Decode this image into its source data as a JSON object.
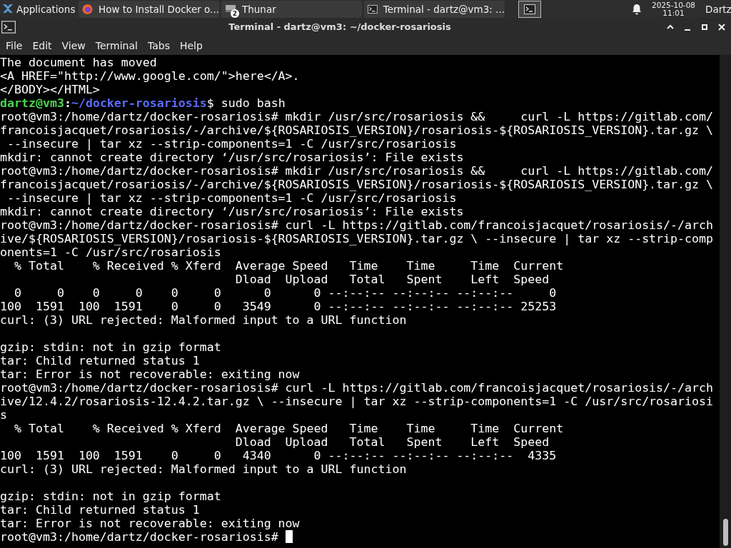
{
  "taskbar": {
    "menu_label": "Applications",
    "tasks": [
      {
        "kind": "browser",
        "label": "How to Install Docker o...",
        "selected": false
      },
      {
        "kind": "files",
        "label": "Thunar",
        "badge": "2",
        "selected": false
      },
      {
        "kind": "terminal",
        "label": "Terminal - dartz@vm3: ...",
        "selected": false
      }
    ],
    "date": "2025-10-08",
    "time": "11:01",
    "user": "Dartz"
  },
  "window": {
    "title": "Terminal - dartz@vm3: ~/docker-rosariosis"
  },
  "menu": [
    "File",
    "Edit",
    "View",
    "Terminal",
    "Tabs",
    "Help"
  ],
  "terminal": {
    "lines": [
      {
        "kind": "text",
        "text": "The document has moved"
      },
      {
        "kind": "text",
        "text": "<A HREF=\"http://www.google.com/\">here</A>."
      },
      {
        "kind": "text",
        "text": "</BODY></HTML>"
      },
      {
        "kind": "prompt",
        "user": "dartz@vm3",
        "separator": ":",
        "path": "~/docker-rosariosis",
        "symbol": "$",
        "command": " sudo bash"
      },
      {
        "kind": "text",
        "text": "root@vm3:/home/dartz/docker-rosariosis# mkdir /usr/src/rosariosis &&     curl -L https://gitlab.com/"
      },
      {
        "kind": "text",
        "text": "francoisjacquet/rosariosis/-/archive/${ROSARIOSIS_VERSION}/rosariosis-${ROSARIOSIS_VERSION}.tar.gz \\"
      },
      {
        "kind": "text",
        "text": " --insecure | tar xz --strip-components=1 -C /usr/src/rosariosis"
      },
      {
        "kind": "text",
        "text": "mkdir: cannot create directory ‘/usr/src/rosariosis’: File exists"
      },
      {
        "kind": "text",
        "text": "root@vm3:/home/dartz/docker-rosariosis# mkdir /usr/src/rosariosis &&     curl -L https://gitlab.com/"
      },
      {
        "kind": "text",
        "text": "francoisjacquet/rosariosis/-/archive/${ROSARIOSIS_VERSION}/rosariosis-${ROSARIOSIS_VERSION}.tar.gz \\"
      },
      {
        "kind": "text",
        "text": " --insecure | tar xz --strip-components=1 -C /usr/src/rosariosis"
      },
      {
        "kind": "text",
        "text": "mkdir: cannot create directory ‘/usr/src/rosariosis’: File exists"
      },
      {
        "kind": "text",
        "text": "root@vm3:/home/dartz/docker-rosariosis# curl -L https://gitlab.com/francoisjacquet/rosariosis/-/arch"
      },
      {
        "kind": "text",
        "text": "ive/${ROSARIOSIS_VERSION}/rosariosis-${ROSARIOSIS_VERSION}.tar.gz \\ --insecure | tar xz --strip-comp"
      },
      {
        "kind": "text",
        "text": "onents=1 -C /usr/src/rosariosis"
      },
      {
        "kind": "text",
        "text": "  % Total    % Received % Xferd  Average Speed   Time    Time     Time  Current"
      },
      {
        "kind": "text",
        "text": "                                 Dload  Upload   Total   Spent    Left  Speed"
      },
      {
        "kind": "text",
        "text": "  0     0    0     0    0     0      0      0 --:--:-- --:--:-- --:--:--     0"
      },
      {
        "kind": "text",
        "text": "100  1591  100  1591    0     0   3549      0 --:--:-- --:--:-- --:--:-- 25253"
      },
      {
        "kind": "text",
        "text": "curl: (3) URL rejected: Malformed input to a URL function"
      },
      {
        "kind": "blank"
      },
      {
        "kind": "text",
        "text": "gzip: stdin: not in gzip format"
      },
      {
        "kind": "text",
        "text": "tar: Child returned status 1"
      },
      {
        "kind": "text",
        "text": "tar: Error is not recoverable: exiting now"
      },
      {
        "kind": "text",
        "text": "root@vm3:/home/dartz/docker-rosariosis# curl -L https://gitlab.com/francoisjacquet/rosariosis/-/arch"
      },
      {
        "kind": "text",
        "text": "ive/12.4.2/rosariosis-12.4.2.tar.gz \\ --insecure | tar xz --strip-components=1 -C /usr/src/rosariosi"
      },
      {
        "kind": "text",
        "text": "s"
      },
      {
        "kind": "text",
        "text": "  % Total    % Received % Xferd  Average Speed   Time    Time     Time  Current"
      },
      {
        "kind": "text",
        "text": "                                 Dload  Upload   Total   Spent    Left  Speed"
      },
      {
        "kind": "text",
        "text": "100  1591  100  1591    0     0   4340      0 --:--:-- --:--:-- --:--:--  4335"
      },
      {
        "kind": "text",
        "text": "curl: (3) URL rejected: Malformed input to a URL function"
      },
      {
        "kind": "blank"
      },
      {
        "kind": "text",
        "text": "gzip: stdin: not in gzip format"
      },
      {
        "kind": "text",
        "text": "tar: Child returned status 1"
      },
      {
        "kind": "text",
        "text": "tar: Error is not recoverable: exiting now"
      },
      {
        "kind": "text",
        "text": "root@vm3:/home/dartz/docker-rosariosis# ",
        "cursor": true
      }
    ]
  }
}
